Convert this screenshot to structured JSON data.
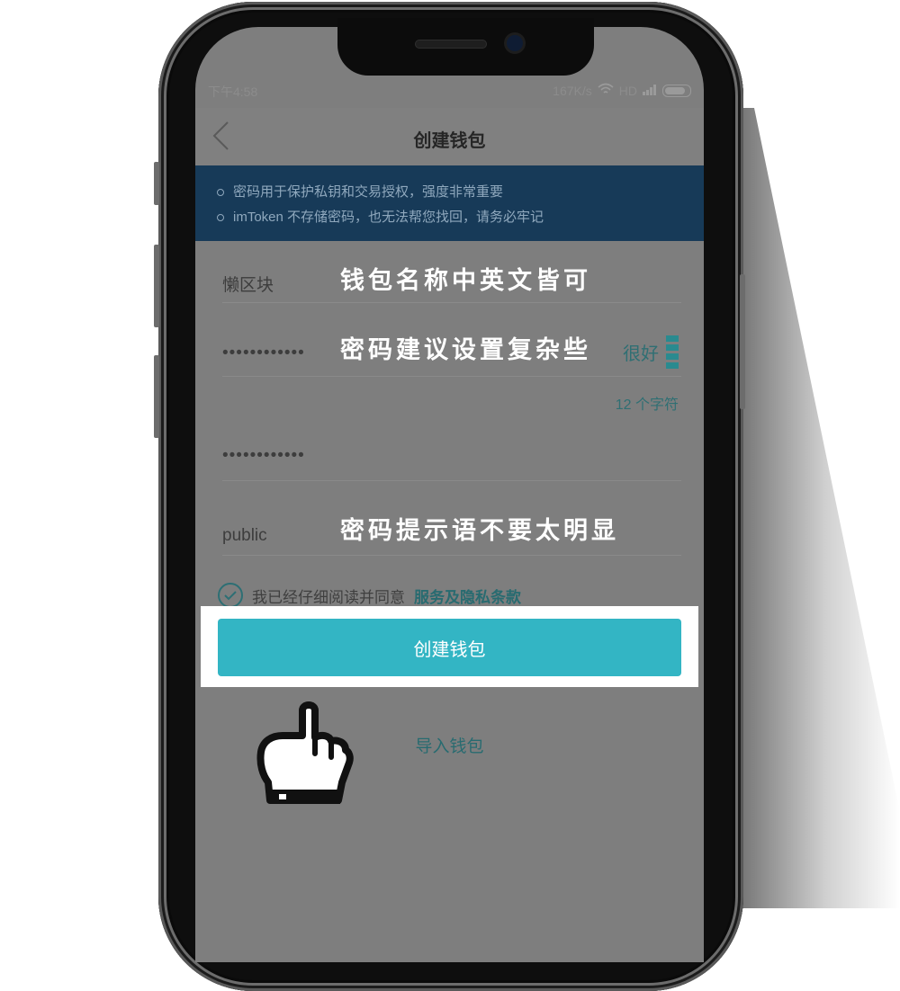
{
  "status_bar": {
    "time": "下午4:58",
    "speed": "167K/s",
    "network": "HD"
  },
  "header": {
    "back_icon": "chevron-left-icon",
    "title": "创建钱包"
  },
  "notice": {
    "lines": [
      "密码用于保护私钥和交易授权，强度非常重要",
      "imToken 不存储密码，也无法帮您找回，请务必牢记"
    ]
  },
  "form": {
    "wallet_name": "懒区块",
    "password_masked": "••••••••••••",
    "password_strength": "很好",
    "char_count": "12 个字符",
    "confirm_masked": "••••••••••••",
    "hint": "public"
  },
  "annotations": {
    "name_tip": "钱包名称中英文皆可",
    "password_tip": "密码建议设置复杂些",
    "hint_tip": "密码提示语不要太明显"
  },
  "agreement": {
    "text": "我已经仔细阅读并同意",
    "link": "服务及隐私条款"
  },
  "buttons": {
    "create": "创建钱包",
    "import": "导入钱包"
  },
  "colors": {
    "accent": "#33b5c4",
    "notice_bg": "#173a58",
    "link": "#286b70"
  }
}
